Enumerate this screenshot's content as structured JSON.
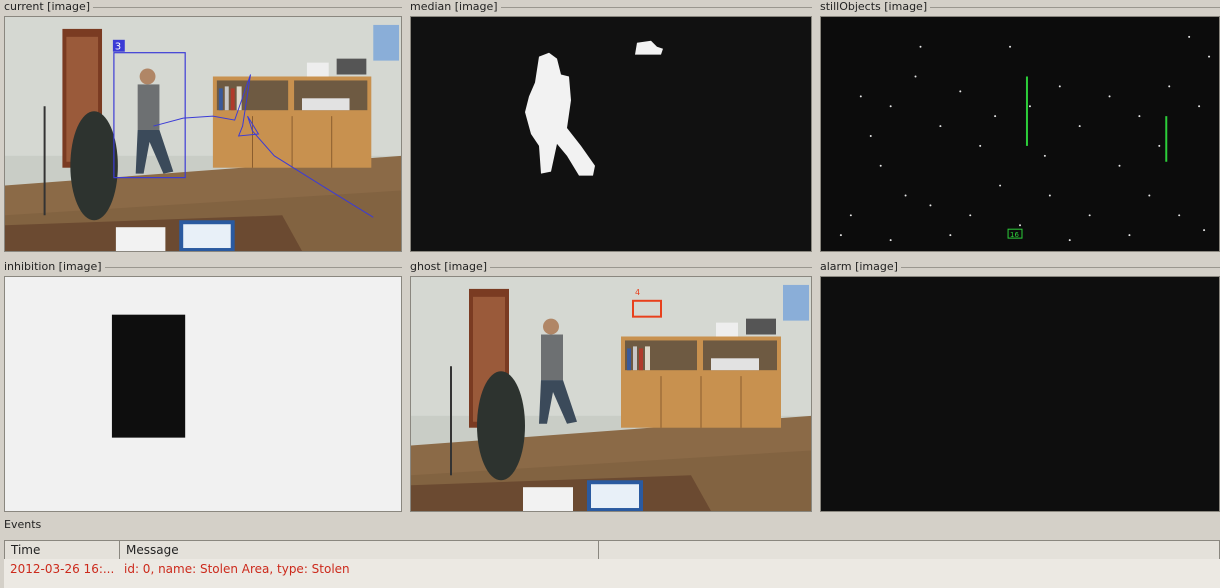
{
  "panels": {
    "current": {
      "title": "current [image]",
      "track_id": "3"
    },
    "median": {
      "title": "median [image]"
    },
    "stillObjects": {
      "title": "stillObjects [image]",
      "box_label": "16"
    },
    "inhibition": {
      "title": "inhibition [image]"
    },
    "ghost": {
      "title": "ghost [image]",
      "box_label": "4"
    },
    "alarm": {
      "title": "alarm [image]"
    }
  },
  "events": {
    "title": "Events",
    "columns": [
      "Time",
      "Message"
    ],
    "rows": [
      {
        "time": "2012-03-26 16:...",
        "message": "id: 0, name: Stolen Area, type: Stolen"
      }
    ]
  },
  "colors": {
    "event_text": "#cc2a1c",
    "track_box": "#3b3bd6",
    "ghost_box": "#e8401c",
    "still_box": "#2ccf3a"
  }
}
